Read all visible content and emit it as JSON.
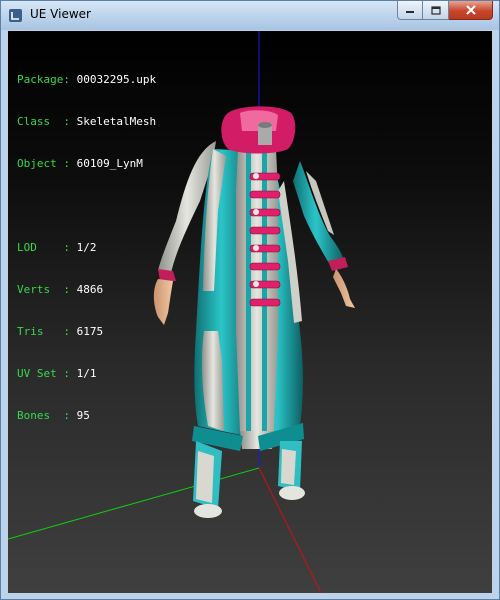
{
  "window": {
    "title": "UE Viewer",
    "controls": {
      "minimize": "minimize",
      "maximize": "maximize",
      "close": "close"
    }
  },
  "info": {
    "package_label": "Package",
    "package_value": "00032295.upk",
    "class_label": "Class  ",
    "class_value": "SkeletalMesh",
    "object_label": "Object ",
    "object_value": "60109_LynM",
    "lod_label": "LOD    ",
    "lod_value": "1/2",
    "verts_label": "Verts  ",
    "verts_value": "4866",
    "tris_label": "Tris   ",
    "tris_value": "6175",
    "uvset_label": "UV Set ",
    "uvset_value": "1/1",
    "bones_label": "Bones  ",
    "bones_value": "95",
    "separator": ": "
  },
  "colors": {
    "info_key": "#38d84c",
    "info_value": "#ffffff",
    "axis_x": "#d01010",
    "axis_y": "#10d010",
    "axis_z": "#1a1ae0",
    "mesh_primary": "#20b2b8",
    "mesh_secondary": "#d8d8d0",
    "mesh_accent": "#e0206c"
  },
  "icons": {
    "app": "app-icon",
    "minimize": "minimize-icon",
    "maximize": "maximize-icon",
    "close": "close-icon"
  }
}
